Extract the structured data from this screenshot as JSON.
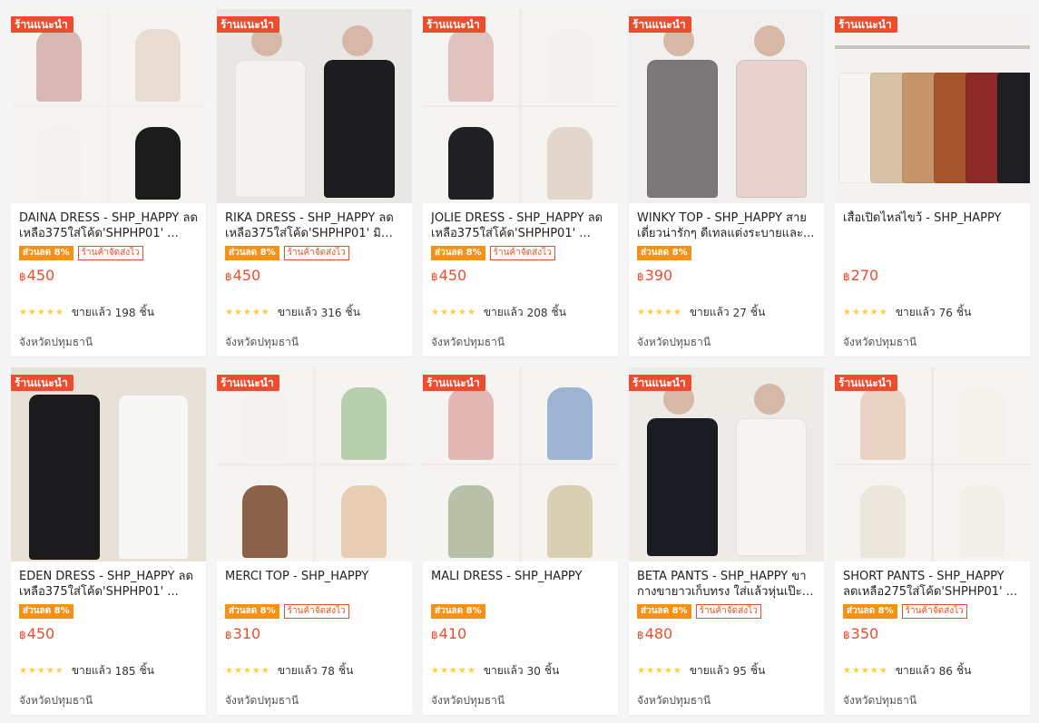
{
  "badge_label": "ร้านแนะนำ",
  "discount_label": "ส่วนลด 8%",
  "fast_ship_label": "ร้านค้าจัดส่งไว",
  "currency": "฿",
  "sold_prefix": "ขายแล้ว",
  "sold_suffix": "ชิ้น",
  "star_glyphs": "★★★★★",
  "accent_color": "#ee4d2d",
  "products": [
    {
      "title": "DAINA DRESS - SHP_HAPPY ลดเหลือ375ใส่โค้ด'SHPHP01' ...",
      "price": "450",
      "sold": "198",
      "location": "จังหวัดปทุมธานี",
      "has_badge": true,
      "has_discount": true,
      "has_fast": true,
      "rating": 5
    },
    {
      "title": "RIKA DRESS - SHP_HAPPY ลดเหลือ375ใส่โค้ด'SHPHP01' มินิเ...",
      "price": "450",
      "sold": "316",
      "location": "จังหวัดปทุมธานี",
      "has_badge": true,
      "has_discount": true,
      "has_fast": true,
      "rating": 5
    },
    {
      "title": "JOLIE DRESS - SHP_HAPPY ลดเหลือ375ใส่โค้ด'SHPHP01' ...",
      "price": "450",
      "sold": "208",
      "location": "จังหวัดปทุมธานี",
      "has_badge": true,
      "has_discount": true,
      "has_fast": true,
      "rating": 5
    },
    {
      "title": "WINKY TOP - SHP_HAPPY สายเดี่ยวน่ารักๆ ดีเทลแต่งระบายและ...",
      "price": "390",
      "sold": "27",
      "location": "จังหวัดปทุมธานี",
      "has_badge": true,
      "has_discount": true,
      "has_fast": false,
      "rating": 5
    },
    {
      "title": "เสื้อเปิดไหล่ไขว้ - SHP_HAPPY",
      "price": "270",
      "sold": "76",
      "location": "จังหวัดปทุมธานี",
      "has_badge": true,
      "has_discount": false,
      "has_fast": false,
      "rating": 5
    },
    {
      "title": "EDEN DRESS - SHP_HAPPY ลดเหลือ375ใส่โค้ด'SHPHP01' ...",
      "price": "450",
      "sold": "185",
      "location": "จังหวัดปทุมธานี",
      "has_badge": true,
      "has_discount": true,
      "has_fast": false,
      "rating": 4.5
    },
    {
      "title": "MERCI TOP - SHP_HAPPY",
      "price": "310",
      "sold": "78",
      "location": "จังหวัดปทุมธานี",
      "has_badge": true,
      "has_discount": true,
      "has_fast": true,
      "rating": 5
    },
    {
      "title": "MALI DRESS - SHP_HAPPY",
      "price": "410",
      "sold": "30",
      "location": "จังหวัดปทุมธานี",
      "has_badge": true,
      "has_discount": true,
      "has_fast": false,
      "rating": 5
    },
    {
      "title": "BETA PANTS - SHP_HAPPY ขากางขายาวเก็บทรง ใส่แล้วหุ่นเป๊ะ ...",
      "price": "480",
      "sold": "95",
      "location": "จังหวัดปทุมธานี",
      "has_badge": true,
      "has_discount": true,
      "has_fast": true,
      "rating": 5
    },
    {
      "title": "SHORT PANTS - SHP_HAPPY ลดเหลือ275ใส่โค้ด'SHPHP01' ...",
      "price": "350",
      "sold": "86",
      "location": "จังหวัดปทุมธานี",
      "has_badge": true,
      "has_discount": true,
      "has_fast": true,
      "rating": 5
    }
  ]
}
